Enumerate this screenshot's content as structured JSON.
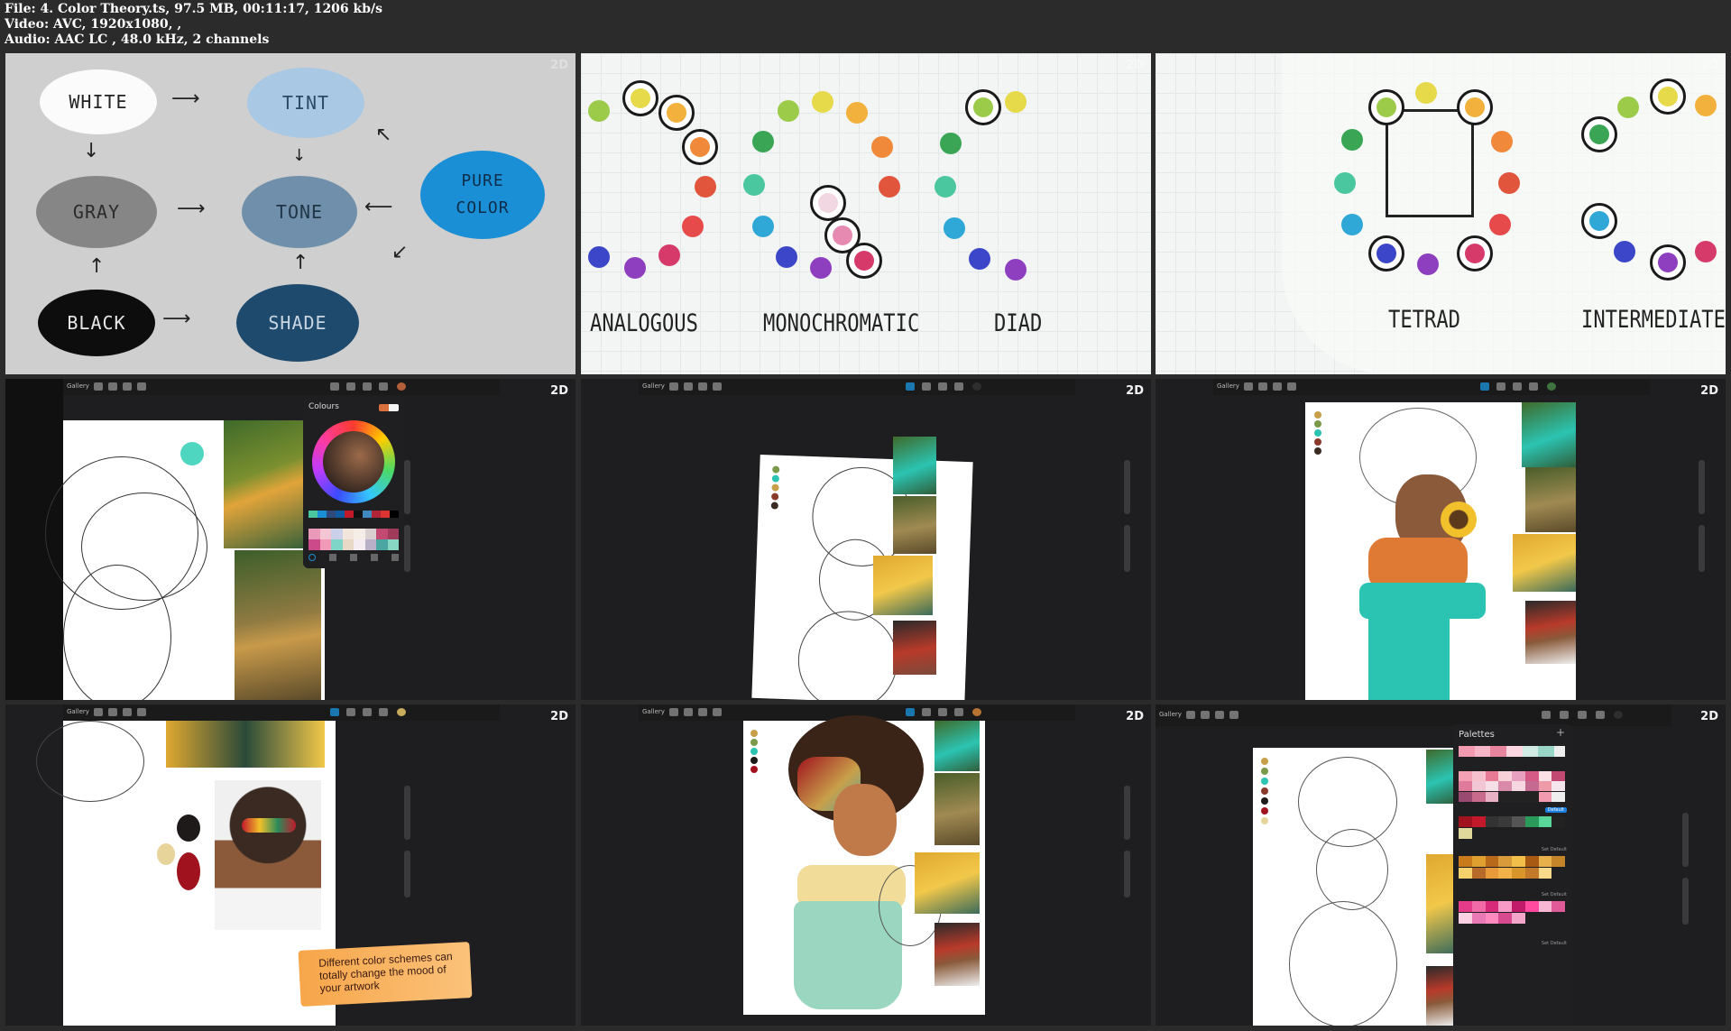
{
  "file_info": {
    "line1": "File: 4. Color Theory.ts, 97.5 MB, 00:11:17, 1206 kb/s",
    "line2": "Video: AVC, 1920x1080, ,",
    "line3": "Audio: AAC LC , 48.0 kHz, 2 channels"
  },
  "logo_text": "2D",
  "flow_chart": {
    "white": "WHITE",
    "tint": "TINT",
    "gray": "GRAY",
    "tone": "TONE",
    "pure_color_line1": "PURE",
    "pure_color_line2": "COLOR",
    "black": "BLACK",
    "shade": "SHADE"
  },
  "harmony_frame_1": {
    "labels": [
      "ANALOGOUS",
      "MONOCHROMATIC",
      "DIAD"
    ]
  },
  "harmony_frame_2": {
    "labels": [
      "TETRAD",
      "INTERMEDIATE"
    ]
  },
  "app": {
    "gallery_label": "Gallery",
    "colours_panel_title": "Colours",
    "palettes_panel_title": "Palettes",
    "default_label": "Default",
    "set_default_label": "Set Default"
  },
  "caption": {
    "line1": "Different color schemes can",
    "line2": "totally change the mood of",
    "line3": "your artwork"
  },
  "colors": {
    "accent_blue": "#1b8fd6",
    "teal": "#2bc4b2",
    "shade_blue": "#1e4a6e",
    "tone_blue": "#6f8faa",
    "tint_blue": "#a9c8e4"
  }
}
